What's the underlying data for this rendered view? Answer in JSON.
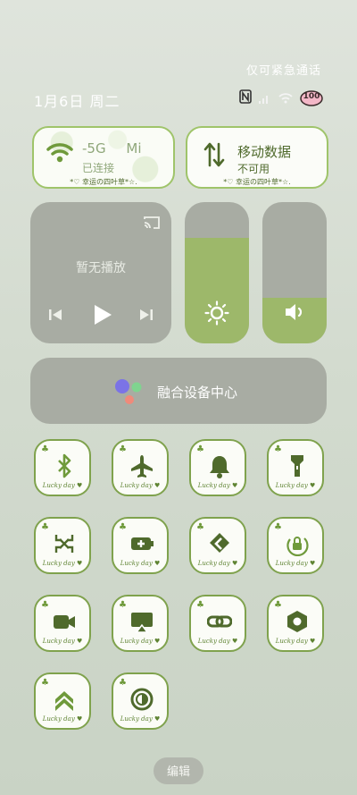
{
  "header": {
    "emergency": "仅可紧急通话",
    "date": "1月6日 周二",
    "battery": "100"
  },
  "wifi_card": {
    "title": "-5G",
    "title_suffix": "Mi",
    "status": "已连接",
    "caption": "*♡ 幸运の四叶草*☆."
  },
  "data_card": {
    "title": "移动数据",
    "status": "不可用",
    "caption": "*♡ 幸运の四叶草*☆."
  },
  "media": {
    "no_playing": "暂无播放"
  },
  "sliders": {
    "brightness": 0.75,
    "volume": 0.32
  },
  "device_center": {
    "label": "融合设备中心"
  },
  "tiles": [
    {
      "icon": "bluetooth-icon",
      "caption": "Lucky day"
    },
    {
      "icon": "airplane-icon",
      "caption": "Lucky day"
    },
    {
      "icon": "bell-icon",
      "caption": "Lucky day"
    },
    {
      "icon": "flashlight-icon",
      "caption": "Lucky day"
    },
    {
      "icon": "screenshot-icon",
      "caption": "Lucky day"
    },
    {
      "icon": "battery-saver-icon",
      "caption": "Lucky day"
    },
    {
      "icon": "data-saver-icon",
      "caption": "Lucky day"
    },
    {
      "icon": "rotation-lock-icon",
      "caption": "Lucky day"
    },
    {
      "icon": "video-icon",
      "caption": "Lucky day"
    },
    {
      "icon": "cast-screen-icon",
      "caption": "Lucky day"
    },
    {
      "icon": "link-icon",
      "caption": "Lucky day"
    },
    {
      "icon": "settings-nut-icon",
      "caption": "Lucky day"
    },
    {
      "icon": "double-chevron-up-icon",
      "caption": "Lucky day"
    },
    {
      "icon": "contrast-icon",
      "caption": "Lucky day"
    }
  ],
  "edit_button": "编辑",
  "colors": {
    "accent_green": "#9db86a",
    "tile_border": "#7fa24d",
    "panel_gray": "#a8aca3"
  }
}
